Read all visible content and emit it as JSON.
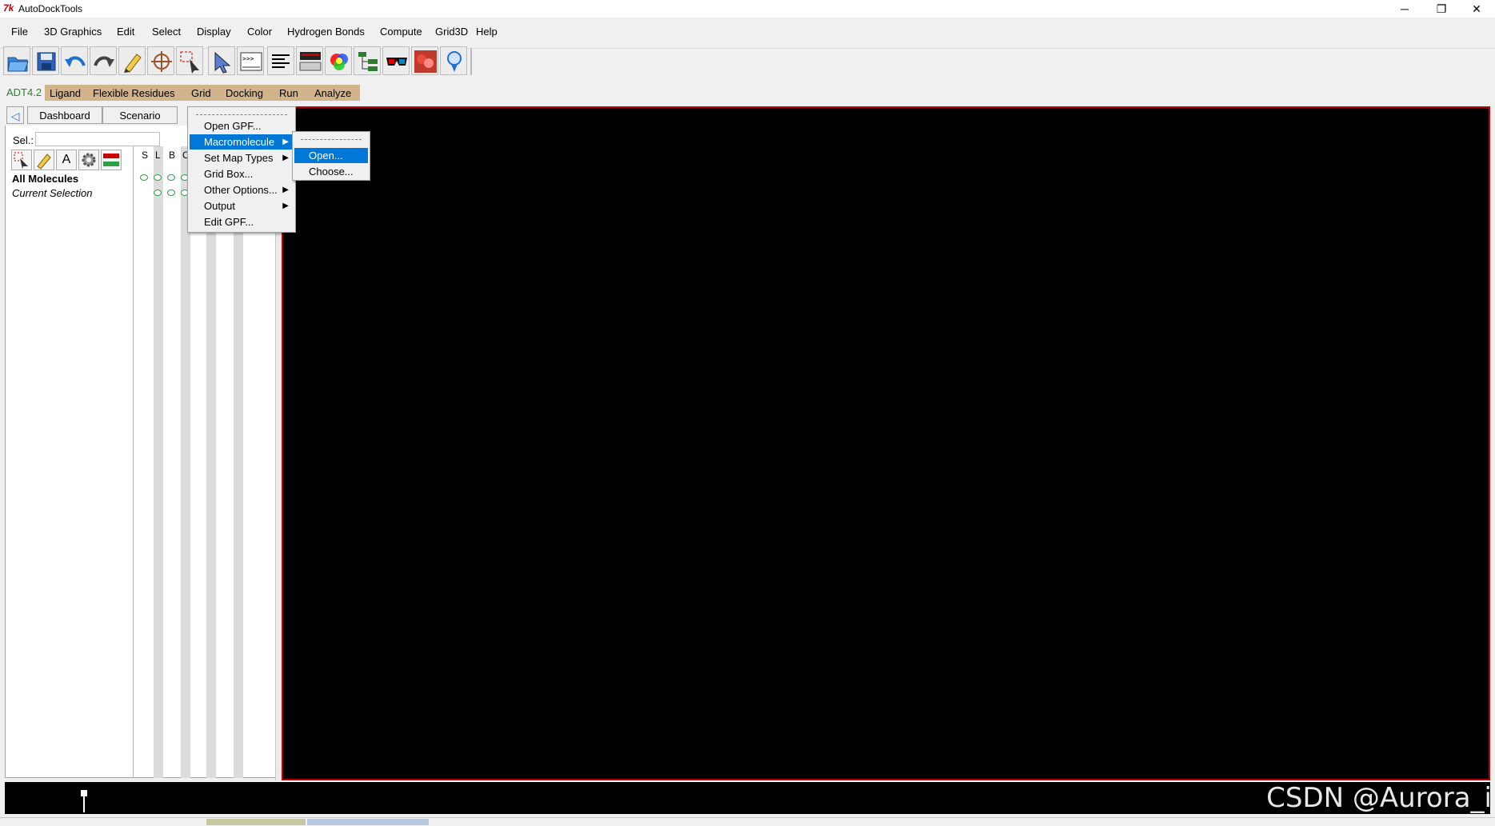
{
  "window": {
    "title": "AutoDockTools",
    "logo_text": "7k",
    "controls": {
      "minimize": "─",
      "maximize": "❐",
      "close": "✕"
    }
  },
  "menubar": {
    "items": [
      "File",
      "3D Graphics",
      "Edit",
      "Select",
      "Display",
      "Color",
      "Hydrogen Bonds",
      "Compute",
      "Grid3D",
      "Help"
    ]
  },
  "toolbar": {
    "tools": [
      "open-icon",
      "save-icon",
      "undo-icon",
      "redo-icon",
      "pencil-icon",
      "crosshair-icon",
      "selection-icon",
      "pointer-icon",
      "python-shell-icon",
      "text-lines-icon",
      "display-icon",
      "color-sphere-icon",
      "hierarchy-icon",
      "glasses-icon",
      "molecule-icon",
      "bulb-icon"
    ],
    "shell_text": ">>>"
  },
  "adt_toolbar": {
    "version": "ADT4.2",
    "items": [
      "Ligand",
      "Flexible Residues",
      "Grid",
      "Docking",
      "Run",
      "Analyze"
    ]
  },
  "left_panel": {
    "tabs": [
      "Dashboard",
      "Scenario"
    ],
    "collapse_icon": "arrow-left-icon",
    "sel_label": "Sel.:",
    "sel_value": "",
    "column_headers": [
      "S",
      "L",
      "B",
      "C"
    ],
    "rows": [
      "All Molecules",
      "Current Selection"
    ]
  },
  "grid_menu": {
    "items": [
      {
        "label": "Open GPF...",
        "submenu": false
      },
      {
        "label": "Macromolecule",
        "submenu": true,
        "active": true
      },
      {
        "label": "Set Map Types",
        "submenu": true
      },
      {
        "label": "Grid Box...",
        "submenu": false
      },
      {
        "label": "Other Options...",
        "submenu": true
      },
      {
        "label": "Output",
        "submenu": true
      },
      {
        "label": "Edit GPF...",
        "submenu": false
      }
    ]
  },
  "macromolecule_menu": {
    "items": [
      {
        "label": "Open...",
        "active": true
      },
      {
        "label": "Choose..."
      }
    ]
  },
  "watermark": "CSDN @Aurora_i",
  "colors": {
    "adt_bar": "#d2b48c",
    "viewer_background": "#000000",
    "viewer_border": "#c00000",
    "menu_highlight": "#0078d7",
    "selection_circle": "#2ea043"
  }
}
